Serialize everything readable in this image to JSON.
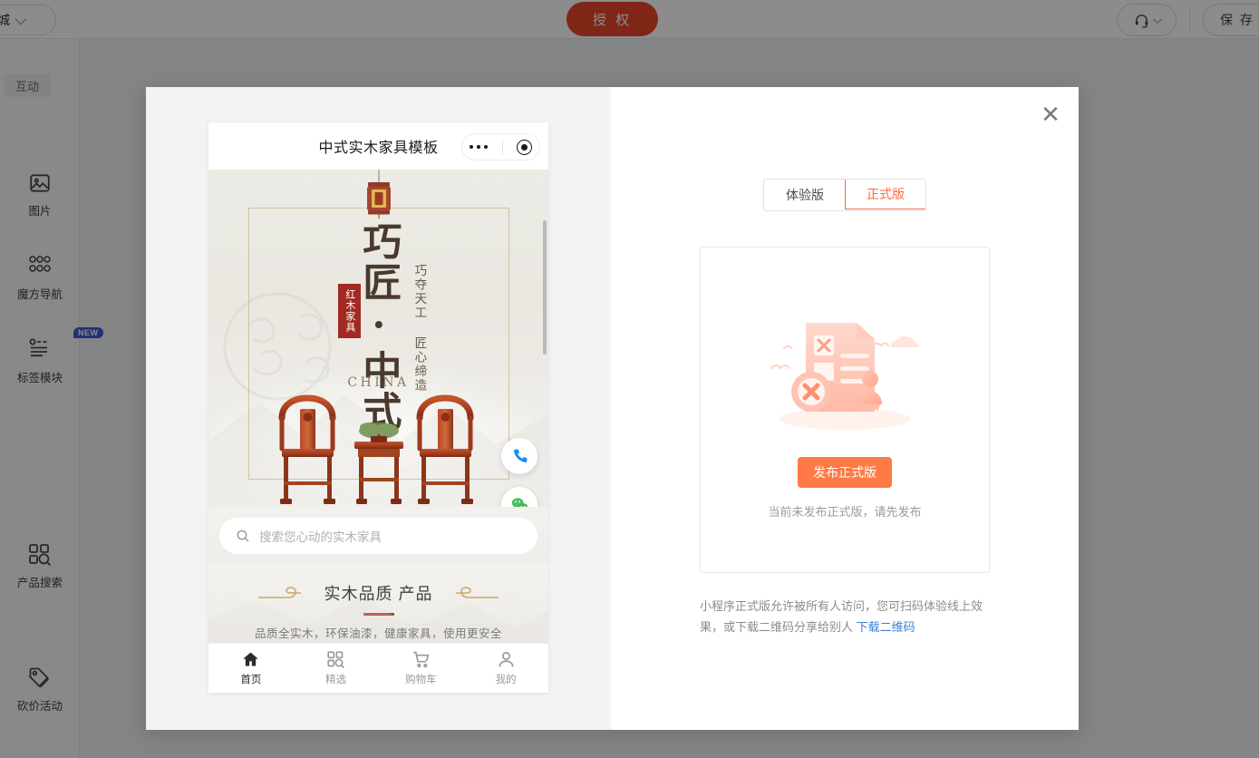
{
  "header": {
    "shop_selector_label": "程序商城",
    "shop_selector_icon": "chevron-down-icon",
    "auth_button_label": "授 权",
    "service_icon": "headset-icon",
    "service_chevron_icon": "chevron-down-icon",
    "save_button_label": "保 存"
  },
  "sidebar": {
    "tab_label": "互动",
    "items": [
      {
        "label": "图片",
        "icon": "image-icon",
        "badge": null
      },
      {
        "label": "魔方导航",
        "icon": "grid-dots-icon",
        "badge": null
      },
      {
        "label": "标签模块",
        "icon": "tag-list-icon",
        "badge": "NEW"
      },
      {
        "label": "产品搜索",
        "icon": "product-search-icon",
        "badge": null
      },
      {
        "label": "砍价活动",
        "icon": "price-tag-icon",
        "badge": null
      }
    ]
  },
  "modal": {
    "close_icon": "close-icon",
    "preview": {
      "nav_title": "中式实木家具模板",
      "capsule_more_icon": "more-dots-icon",
      "capsule_target_icon": "target-circle-icon",
      "poster": {
        "main_title": "巧匠·中式",
        "side_text": "巧夺天工 匠心缔造",
        "seal_text": "红木家具",
        "english": "CHINA",
        "lantern_icon": "lantern-icon",
        "furniture_icon": "rosewood-chairs-image"
      },
      "fabs": [
        {
          "icon": "phone-icon",
          "color": "#1989fa"
        },
        {
          "icon": "wechat-icon",
          "color": "#4ac264"
        }
      ],
      "search": {
        "placeholder": "搜索您心动的实木家具",
        "icon": "search-icon"
      },
      "quality": {
        "title": "实木品质 产品",
        "subtitle": "品质全实木，环保油漆，健康家具，使用更安全",
        "ornament_icon": "cloud-scroll-icon"
      },
      "tabbar": [
        {
          "label": "首页",
          "icon": "home-icon",
          "active": true
        },
        {
          "label": "精选",
          "icon": "grid-search-icon",
          "active": false
        },
        {
          "label": "购物车",
          "icon": "cart-icon",
          "active": false
        },
        {
          "label": "我的",
          "icon": "user-icon",
          "active": false
        }
      ]
    },
    "right": {
      "segments": [
        {
          "label": "体验版",
          "active": false
        },
        {
          "label": "正式版",
          "active": true
        }
      ],
      "illustration_icon": "empty-document-error-illustration",
      "publish_button_label": "发布正式版",
      "publish_hint": "当前未发布正式版，请先发布",
      "description_text": "小程序正式版允许被所有人访问，您可扫码体验线上效果，或下载二维码分享给别人 ",
      "download_link_label": "下载二维码"
    }
  },
  "colors": {
    "auth_red": "#e8452b",
    "accent_orange": "#ff7a45",
    "active_segment": "#ff6a3d",
    "link_blue": "#3b7fd4",
    "badge_blue": "#3a5bd9",
    "seal_red": "#a32a22"
  }
}
